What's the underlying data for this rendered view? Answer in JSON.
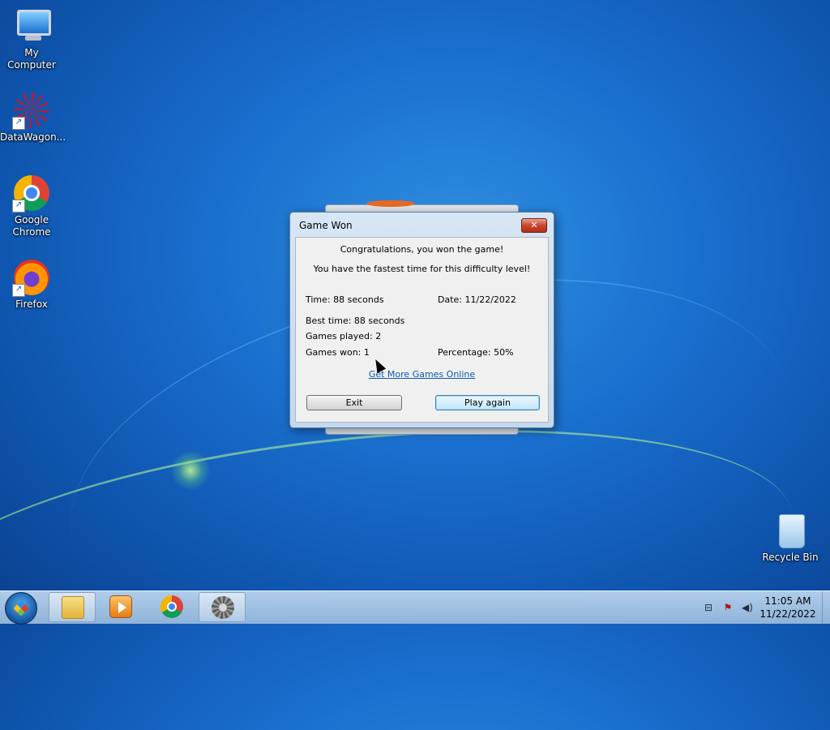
{
  "desktop": {
    "icons": [
      {
        "label": "My Computer",
        "icon": "computer-icon"
      },
      {
        "label": "DataWagon...",
        "icon": "datawagon-icon"
      },
      {
        "label": "Google Chrome",
        "icon": "chrome-icon"
      },
      {
        "label": "Firefox",
        "icon": "firefox-icon"
      },
      {
        "label": "Recycle Bin",
        "icon": "recycle-bin-icon"
      }
    ]
  },
  "dialog": {
    "title": "Game Won",
    "close_glyph": "✕",
    "congrats": "Congratulations, you won the game!",
    "fastest": "You have the fastest time for this difficulty level!",
    "time": "Time: 88 seconds",
    "date": "Date: 11/22/2022",
    "best_time": "Best time: 88 seconds",
    "games_played": "Games played: 2",
    "games_won": "Games won: 1",
    "percentage": "Percentage: 50%",
    "link": "Get More Games Online",
    "exit_label": "Exit",
    "play_again_label": "Play again"
  },
  "taskbar": {
    "start_icon": "windows-start-icon",
    "pinned": [
      {
        "name": "windows-explorer",
        "icon": "folder-icon"
      },
      {
        "name": "windows-media-player",
        "icon": "media-player-icon"
      },
      {
        "name": "google-chrome",
        "icon": "chrome-icon"
      },
      {
        "name": "minesweeper",
        "icon": "gear-icon",
        "active": true
      }
    ],
    "tray": {
      "network_icon": "network-icon",
      "flag_icon": "action-center-flag-icon",
      "volume_icon": "volume-icon"
    },
    "clock": {
      "time": "11:05 AM",
      "date": "11/22/2022"
    }
  }
}
